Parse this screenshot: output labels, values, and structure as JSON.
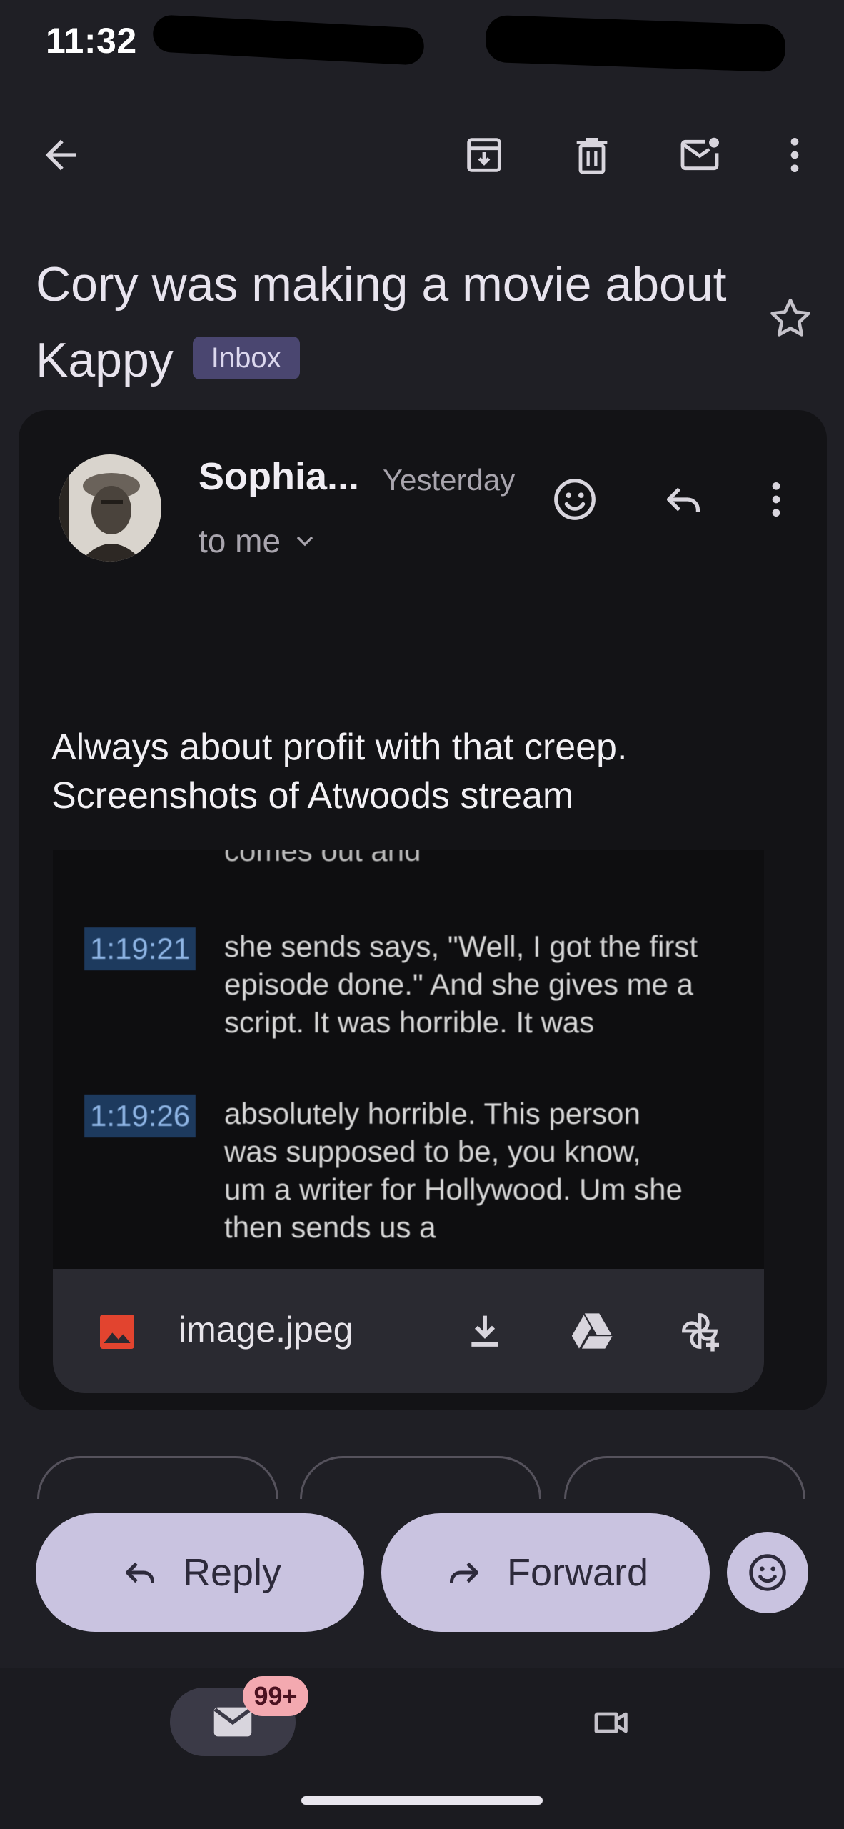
{
  "status_bar": {
    "time": "11:32"
  },
  "toolbar": {
    "back_icon": "arrow-back-icon",
    "archive_icon": "archive-icon",
    "delete_icon": "trash-icon",
    "mark_unread_icon": "mail-unread-icon",
    "more_icon": "more-vert-icon"
  },
  "subject": {
    "title": "Cory was making a movie about Kappy",
    "label": "Inbox"
  },
  "message": {
    "sender": "Sophia...",
    "date": "Yesterday",
    "recipient": "to me",
    "body_lines": [
      "Always about profit with that creep.",
      "Screenshots of Atwoods stream"
    ]
  },
  "image_content": {
    "partial_top": "comes out and",
    "rows": [
      {
        "timestamp": "1:19:21",
        "lines": [
          "she sends says, \"Well, I got the first",
          "episode done.\" And she gives me a",
          "script. It was horrible. It was"
        ]
      },
      {
        "timestamp": "1:19:26",
        "lines": [
          "absolutely horrible. This person",
          "was supposed to be, you know,",
          "um a writer for Hollywood. Um she",
          "then sends us a"
        ]
      }
    ]
  },
  "attachment": {
    "filename": "image.jpeg",
    "icon": "image-file-icon"
  },
  "actions": {
    "reply_label": "Reply",
    "forward_label": "Forward"
  },
  "bottom_nav": {
    "mail_badge": "99+"
  },
  "colors": {
    "background": "#1f1f25",
    "card": "#131316",
    "pill": "#c9c3e0",
    "badge": "#f3a9b0",
    "inbox_label": "#4a4670",
    "file_icon": "#e2442f"
  }
}
